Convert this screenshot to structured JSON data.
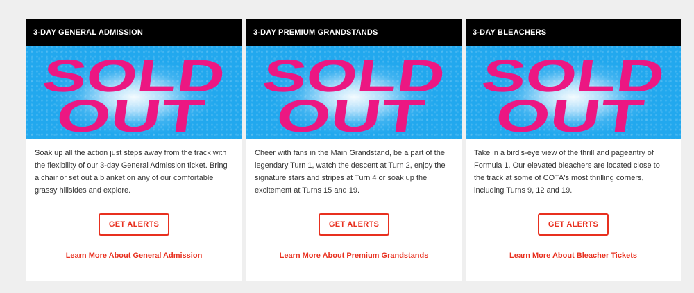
{
  "accent_color": "#e8301f",
  "sold_out_color": "#ec1782",
  "cards": [
    {
      "title": "3-DAY GENERAL ADMISSION",
      "banner": {
        "line1": "SOLD",
        "line2": "OUT"
      },
      "description": "Soak up all the action just steps away from the track with the flexibility of our 3-day General Admission ticket. Bring a chair or set out a blanket on any of our comfortable grassy hillsides and explore.",
      "button_label": "GET ALERTS",
      "link_label": "Learn More About General Admission"
    },
    {
      "title": "3-DAY PREMIUM GRANDSTANDS",
      "banner": {
        "line1": "SOLD",
        "line2": "OUT"
      },
      "description": "Cheer with fans in the Main Grandstand, be a part of the legendary Turn 1, watch the descent at Turn 2, enjoy the signature stars and stripes at Turn 4 or soak up the excitement at Turns 15 and 19.",
      "button_label": "GET ALERTS",
      "link_label": "Learn More About Premium Grandstands"
    },
    {
      "title": "3-DAY BLEACHERS",
      "banner": {
        "line1": "SOLD",
        "line2": "OUT"
      },
      "description": "Take in a bird's-eye view of the thrill and pageantry of Formula 1. Our elevated bleachers are located close to the track at some of COTA's most thrilling corners, including Turns 9, 12 and 19.",
      "button_label": "GET ALERTS",
      "link_label": "Learn More About Bleacher Tickets"
    }
  ]
}
